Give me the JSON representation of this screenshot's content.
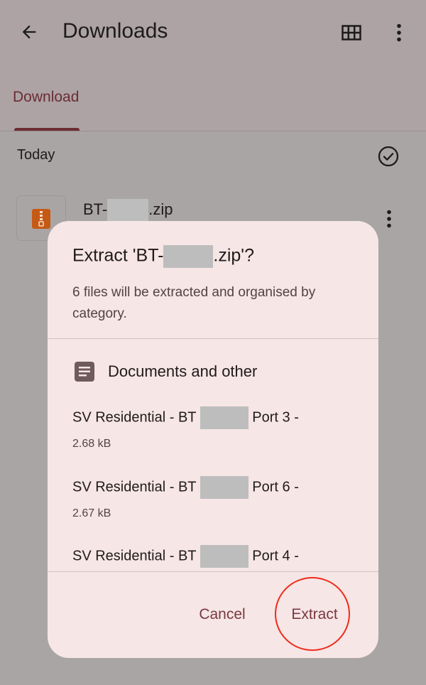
{
  "header": {
    "title": "Downloads",
    "back_icon": "arrow-back-icon",
    "grid_icon": "grid-view-icon",
    "more_icon": "more-vert-icon"
  },
  "tabs": [
    {
      "label": "Download",
      "selected": true
    }
  ],
  "list": {
    "section_label": "Today",
    "select_all_icon": "check-circle-icon",
    "file": {
      "name_prefix": "BT-",
      "name_suffix": ".zip",
      "icon": "zip-file-icon"
    }
  },
  "dialog": {
    "title_prefix": "Extract 'BT-",
    "title_suffix": ".zip'?",
    "body": "6 files will be extracted and organised by category.",
    "category": {
      "label": "Documents and other",
      "icon": "document-icon"
    },
    "items": [
      {
        "name_prefix": "SV Residential - BT",
        "name_suffix": "Port 3 -",
        "size": "2.68 kB"
      },
      {
        "name_prefix": "SV Residential - BT",
        "name_suffix": "Port 6 -",
        "size": "2.67 kB"
      },
      {
        "name_prefix": "SV Residential - BT",
        "name_suffix": "Port 4 -"
      }
    ],
    "buttons": {
      "cancel": "Cancel",
      "extract": "Extract"
    }
  },
  "colors": {
    "accent": "#7a3840",
    "dialog_bg": "#f6e6e5",
    "highlight_ring": "#ee2b1b"
  }
}
